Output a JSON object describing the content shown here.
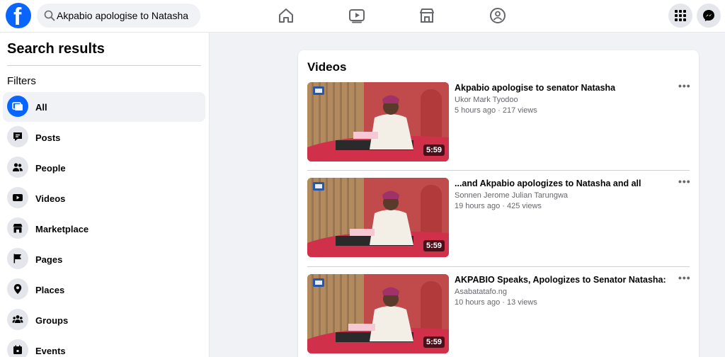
{
  "header": {
    "logo_letter": "f",
    "search": {
      "value": "Akpabio apologise to Natasha",
      "placeholder": "Search Facebook"
    },
    "nav_icons": [
      "home-icon",
      "video-icon",
      "marketplace-icon",
      "groups-icon"
    ],
    "right_icons": [
      "menu-grid-icon",
      "messenger-icon"
    ],
    "brand_color": "#0866ff"
  },
  "sidebar": {
    "title": "Search results",
    "filters_label": "Filters",
    "items": [
      {
        "label": "All",
        "icon": "all-icon",
        "active": true
      },
      {
        "label": "Posts",
        "icon": "posts-icon"
      },
      {
        "label": "People",
        "icon": "people-icon"
      },
      {
        "label": "Videos",
        "icon": "video-icon"
      },
      {
        "label": "Marketplace",
        "icon": "marketplace-icon"
      },
      {
        "label": "Pages",
        "icon": "flag-icon"
      },
      {
        "label": "Places",
        "icon": "location-pin-icon"
      },
      {
        "label": "Groups",
        "icon": "groups-icon"
      },
      {
        "label": "Events",
        "icon": "calendar-icon"
      }
    ]
  },
  "main": {
    "section_title": "Videos",
    "videos": [
      {
        "title": "Akpabio apologise to senator Natasha",
        "author": "Ukor Mark Tyodoo",
        "meta": "5 hours ago · 217 views",
        "duration": "5:59"
      },
      {
        "title": "...and Akpabio apologizes to Natasha and all",
        "author": "Sonnen Jerome Julian Tarungwa",
        "meta": "19 hours ago · 425 views",
        "duration": "5:59"
      },
      {
        "title": "AKPABIO Speaks, Apologizes to Senator Natasha:",
        "author": "Asabatatafo.ng",
        "meta": "10 hours ago · 13 views",
        "duration": "5:59"
      }
    ]
  }
}
